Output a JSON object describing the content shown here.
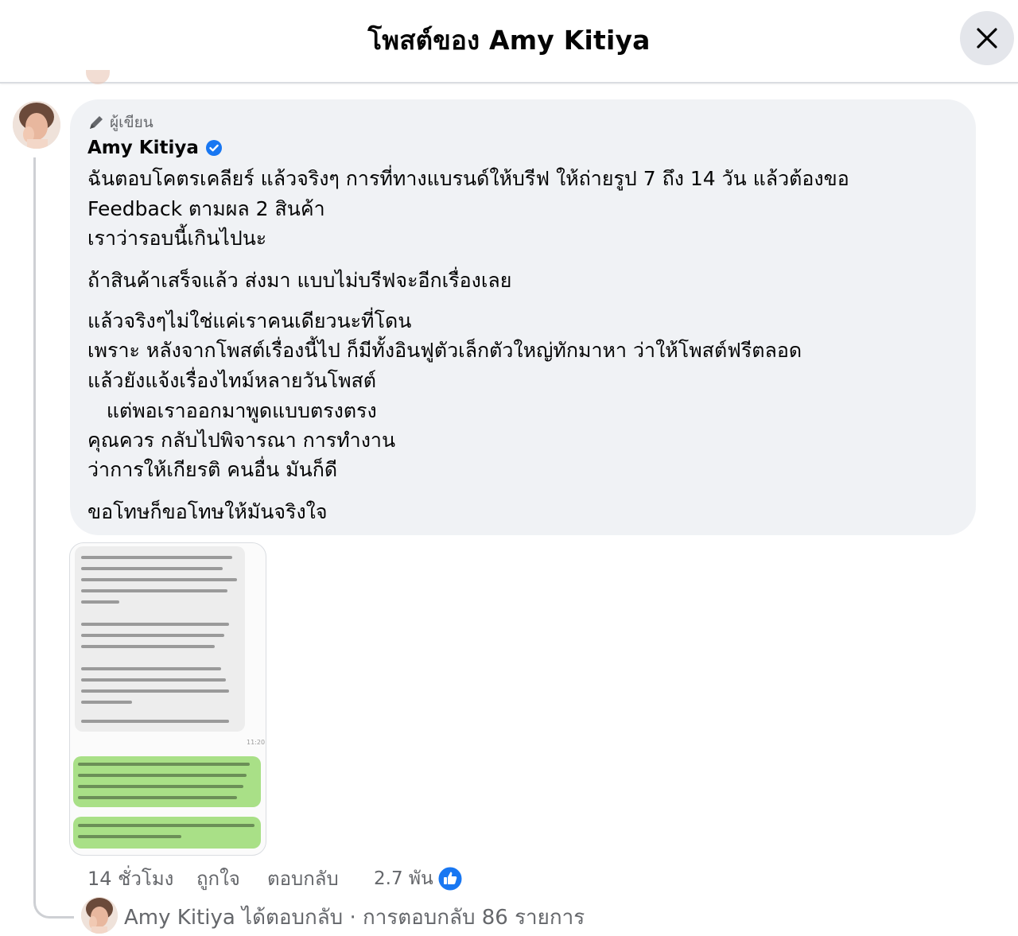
{
  "header": {
    "title": "โพสต์ของ Amy Kitiya",
    "close_icon": "close-icon"
  },
  "comment": {
    "author_badge": "ผู้เขียน",
    "author_badge_icon": "pencil-icon",
    "author_name": "Amy Kitiya",
    "verified_icon": "verified-badge-icon",
    "text_lines": [
      "ฉันตอบโคตรเคลียร์ แล้วจริงๆ การที่ทางแบรนด์ให้บรีฟ ให้ถ่ายรูป 7 ถึง 14 วัน แล้วต้องขอ",
      "Feedback ตามผล 2 สินค้า",
      "เราว่ารอบนี้เกินไปนะ",
      "ถ้าสินค้าเสร็จแล้ว ส่งมา แบบไม่บรีฟจะอีกเรื่องเลย",
      "แล้วจริงๆไม่ใช่แค่เราคนเดียวนะที่โดน",
      "เพราะ หลังจากโพสต์เรื่องนี้ไป ก็มีทั้งอินฟูตัวเล็กตัวใหญ่ทักมาหา ว่าให้โพสต์ฟรีตลอด",
      "แล้วยังแจ้งเรื่องไทม์หลายวันโพสต์",
      "   แต่พอเราออกมาพูดแบบตรงตรง",
      "คุณควร กลับไปพิจารณา การทำงาน",
      "ว่าการให้เกียรติ คนอื่น มันก็ดี",
      "ขอโทษก็ขอโทษให้มันจริงใจ"
    ],
    "attachment": {
      "type": "chat-screenshot"
    },
    "actions": {
      "time": "14 ชั่วโมง",
      "like": "ถูกใจ",
      "reply": "ตอบกลับ",
      "reaction_count": "2.7 พัน",
      "reaction_icon": "like-reaction-icon"
    },
    "reply_summary": "Amy Kitiya ได้ตอบกลับ · การตอบกลับ 86 รายการ"
  },
  "colors": {
    "bubble_bg": "#f0f2f5",
    "secondary_text": "#65676b",
    "verified_blue": "#1877f2",
    "chat_green": "#a9e087"
  }
}
